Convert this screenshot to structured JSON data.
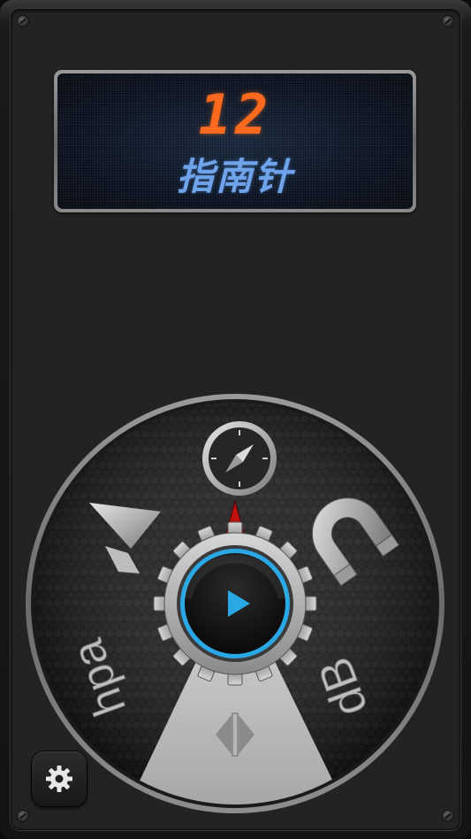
{
  "display": {
    "number": "12",
    "title": "指南针"
  },
  "dial": {
    "top_tool": "compass-icon",
    "left_tool": "arrow-logo-icon",
    "right_tool": "magnet-icon",
    "lower_left_label": "hpa",
    "lower_right_label": "dB",
    "center_button": "play-icon",
    "bottom_segment": "sound-level-icon"
  },
  "settings": {
    "icon": "gear-icon"
  },
  "colors": {
    "lcd_number": "#ff6a1f",
    "lcd_title": "#6fa4ea",
    "play_accent": "#2aa8e6",
    "pointer": "#c0120f"
  }
}
